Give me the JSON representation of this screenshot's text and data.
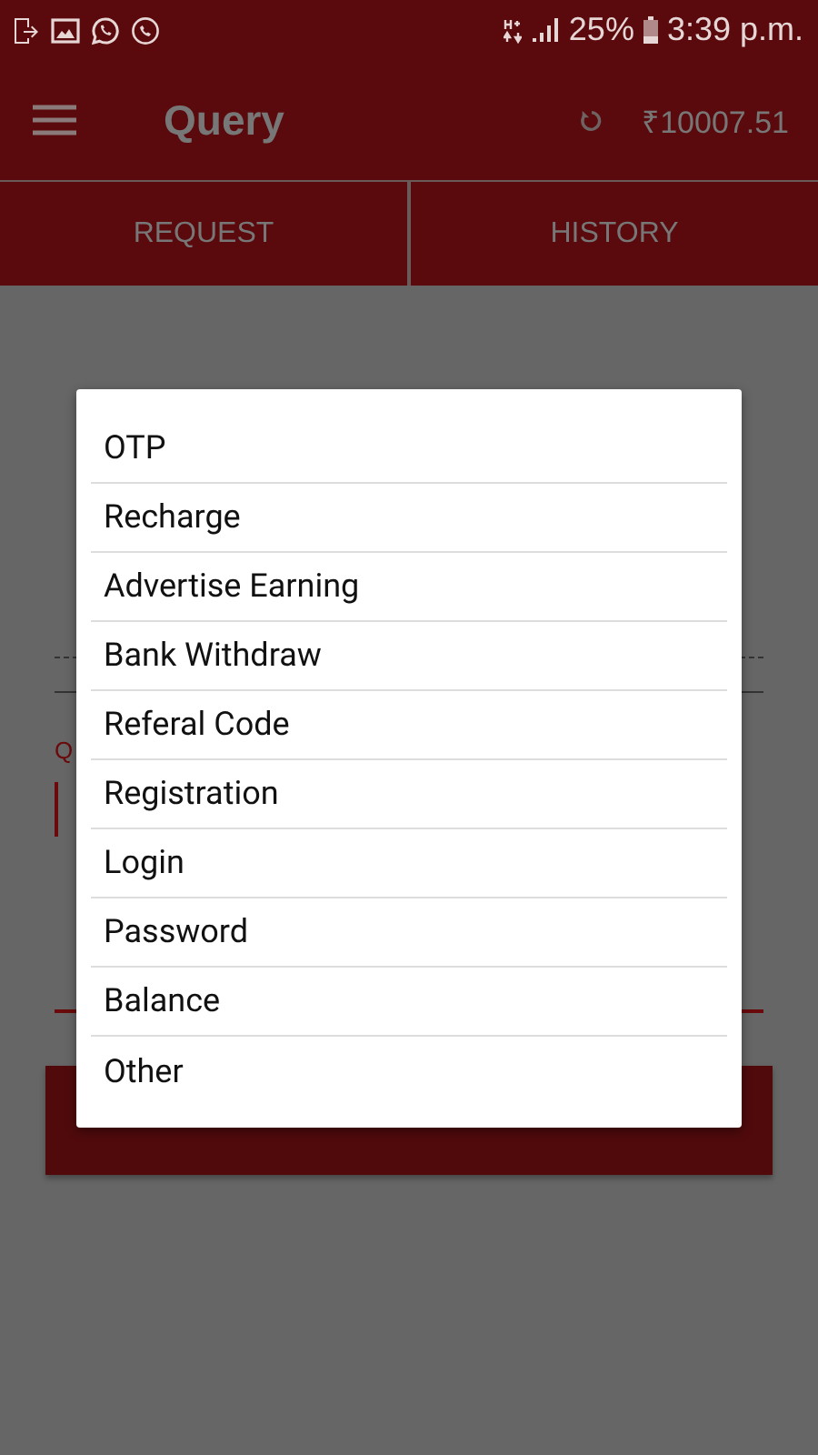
{
  "status_bar": {
    "battery": "25%",
    "time": "3:39 p.m."
  },
  "toolbar": {
    "title": "Query",
    "balance": "₹10007.51"
  },
  "tabs": [
    {
      "label": "REQUEST"
    },
    {
      "label": "HISTORY"
    }
  ],
  "form": {
    "field_label": "Q"
  },
  "dialog": {
    "options": [
      "OTP",
      "Recharge",
      "Advertise Earning",
      "Bank Withdraw",
      "Referal Code",
      "Registration",
      "Login",
      "Password",
      "Balance",
      "Other"
    ]
  }
}
